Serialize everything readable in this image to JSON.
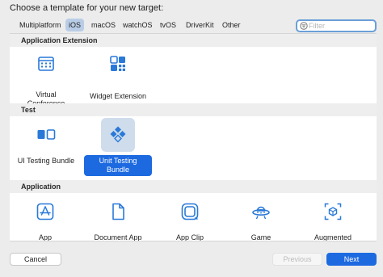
{
  "prompt": "Choose a template for your new target:",
  "platform_tabs": [
    {
      "label": "Multiplatform",
      "selected": false
    },
    {
      "label": "iOS",
      "selected": true
    },
    {
      "label": "macOS",
      "selected": false
    },
    {
      "label": "watchOS",
      "selected": false
    },
    {
      "label": "tvOS",
      "selected": false
    },
    {
      "label": "DriverKit",
      "selected": false
    },
    {
      "label": "Other",
      "selected": false
    }
  ],
  "filter": {
    "placeholder": "Filter",
    "icon": "filter-icon"
  },
  "sections": [
    {
      "title": "Application Extension",
      "items": [
        {
          "label": "Virtual\nConference",
          "icon": "calendar-grid-icon",
          "selected": false
        },
        {
          "label": "Widget Extension",
          "icon": "widget-grid-icon",
          "selected": false
        }
      ]
    },
    {
      "title": "Test",
      "items": [
        {
          "label": "UI Testing Bundle",
          "icon": "ui-test-icon",
          "selected": false
        },
        {
          "label": "Unit Testing\nBundle",
          "icon": "diamond-grid-icon",
          "selected": true
        }
      ]
    },
    {
      "title": "Application",
      "items": [
        {
          "label": "App",
          "icon": "app-store-icon",
          "selected": false
        },
        {
          "label": "Document App",
          "icon": "document-icon",
          "selected": false
        },
        {
          "label": "App Clip",
          "icon": "app-clip-icon",
          "selected": false
        },
        {
          "label": "Game",
          "icon": "game-ufo-icon",
          "selected": false
        },
        {
          "label": "Augmented",
          "icon": "augmented-cube-icon",
          "selected": false
        }
      ]
    }
  ],
  "buttons": {
    "cancel": "Cancel",
    "previous": "Previous",
    "next": "Next"
  },
  "colors": {
    "accent": "#1d6ae0",
    "icon_blue": "#2979d8",
    "selected_tile": "#cfdcec",
    "selected_tab": "#b9cde6"
  }
}
